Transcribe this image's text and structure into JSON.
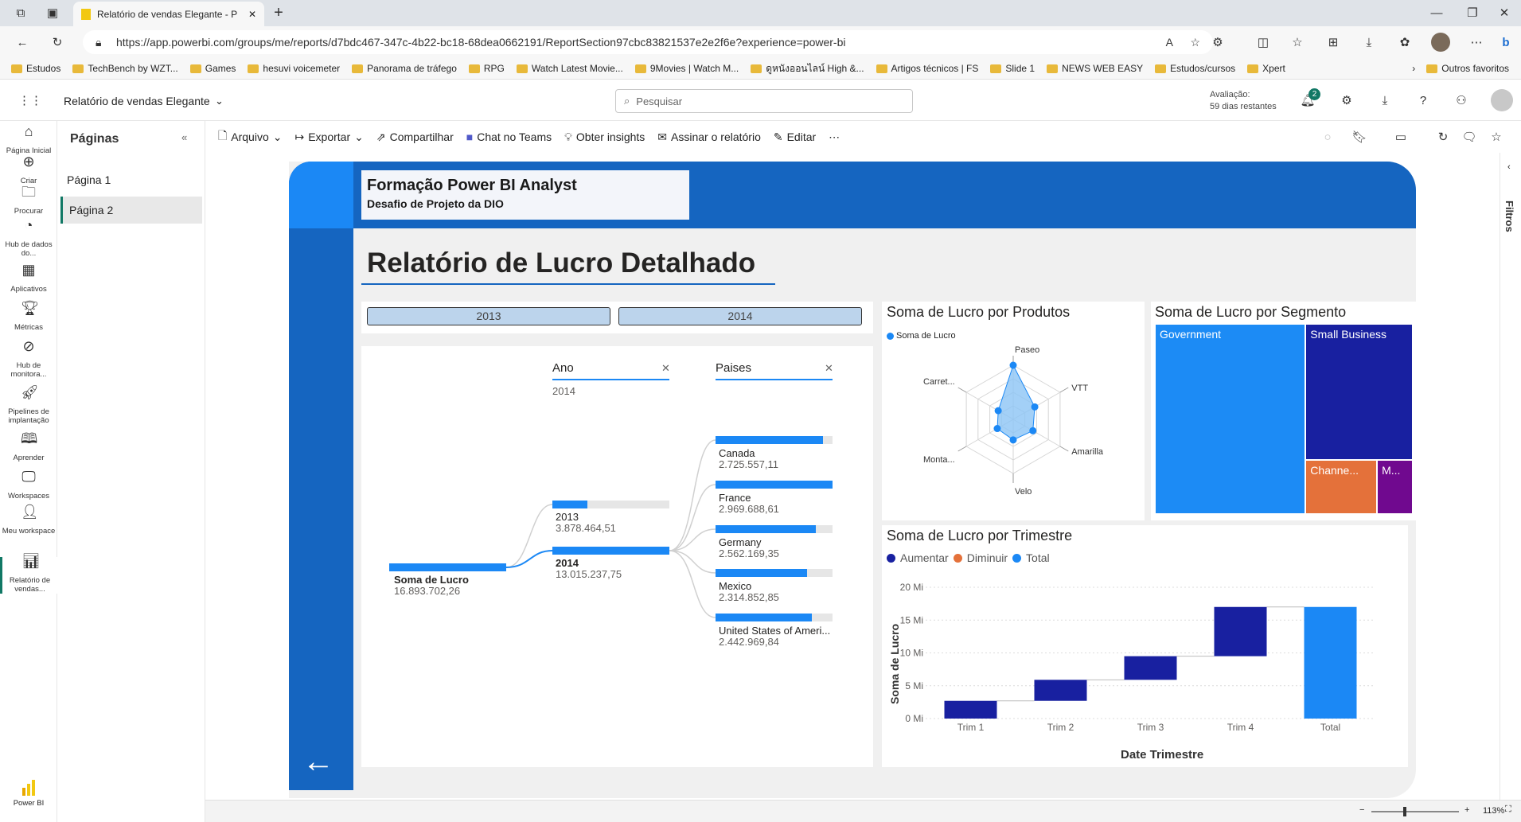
{
  "browser": {
    "tab_title": "Relatório de vendas Elegante - P",
    "url": "https://app.powerbi.com/groups/me/reports/d7bdc467-347c-4b22-bc18-68dea0662191/ReportSection97cbc83821537e2e2f6e?experience=power-bi",
    "bookmarks": [
      "Estudos",
      "TechBench by WZT...",
      "Games",
      "hesuvi voicemeter",
      "Panorama de tráfego",
      "RPG",
      "Watch Latest Movie...",
      "9Movies | Watch M...",
      "ดูหนังออนไลน์ High &...",
      "Artigos técnicos | FS",
      "Slide 1",
      "NEWS WEB EASY",
      "Estudos/cursos",
      "Xpert"
    ],
    "other_favorites": "Outros favoritos"
  },
  "header": {
    "report_name": "Relatório de vendas Elegante",
    "search_placeholder": "Pesquisar",
    "trial_label": "Avaliação:",
    "trial_days": "59 dias restantes",
    "notif_count": "2"
  },
  "nav": [
    {
      "label": "Página Inicial",
      "icon": "home-icon"
    },
    {
      "label": "Criar",
      "icon": "plus-circle-icon"
    },
    {
      "label": "Procurar",
      "icon": "folder-icon"
    },
    {
      "label": "Hub de dados do...",
      "icon": "data-hub-icon"
    },
    {
      "label": "Aplicativos",
      "icon": "apps-icon"
    },
    {
      "label": "Métricas",
      "icon": "trophy-icon"
    },
    {
      "label": "Hub de monitora...",
      "icon": "monitor-icon"
    },
    {
      "label": "Pipelines de implantação",
      "icon": "rocket-icon"
    },
    {
      "label": "Aprender",
      "icon": "book-icon"
    },
    {
      "label": "Workspaces",
      "icon": "workspaces-icon"
    },
    {
      "label": "Meu workspace",
      "icon": "person-icon"
    },
    {
      "label": "Relatório de vendas...",
      "icon": "report-icon"
    }
  ],
  "powerbi_label": "Power BI",
  "pages_panel": {
    "title": "Páginas",
    "pages": [
      "Página 1",
      "Página 2"
    ]
  },
  "toolbar": {
    "arquivo": "Arquivo",
    "exportar": "Exportar",
    "compartilhar": "Compartilhar",
    "teams": "Chat no Teams",
    "insights": "Obter insights",
    "assinar": "Assinar o relatório",
    "editar": "Editar"
  },
  "filters_label": "Filtros",
  "zoom": "113%",
  "report": {
    "banner_title": "Formação Power BI Analyst",
    "banner_subtitle": "Desafio de Projeto da DIO",
    "main_title": "Relatório de Lucro Detalhado",
    "slicer": [
      "2013",
      "2014"
    ],
    "decomp": {
      "col1": "Ano",
      "col1_sel": "2014",
      "col2": "Paises",
      "root_label": "Soma de Lucro",
      "root_value": "16.893.702,26",
      "years": [
        {
          "label": "2013",
          "value": "3.878.464,51",
          "frac": 0.3
        },
        {
          "label": "2014",
          "value": "13.015.237,75",
          "frac": 1.0
        }
      ],
      "countries": [
        {
          "label": "Canada",
          "value": "2.725.557,11",
          "frac": 0.92
        },
        {
          "label": "France",
          "value": "2.969.688,61",
          "frac": 1.0
        },
        {
          "label": "Germany",
          "value": "2.562.169,35",
          "frac": 0.86
        },
        {
          "label": "Mexico",
          "value": "2.314.852,85",
          "frac": 0.78
        },
        {
          "label": "United States of Ameri...",
          "value": "2.442.969,84",
          "frac": 0.82
        }
      ]
    },
    "radar": {
      "title": "Soma de Lucro por Produtos",
      "legend": "Soma de Lucro"
    },
    "treemap": {
      "title": "Soma de Lucro por Segmento",
      "segments": [
        "Government",
        "Small Business",
        "Channe...",
        "M..."
      ]
    },
    "waterfall": {
      "title": "Soma de Lucro por Trimestre",
      "legend": [
        "Aumentar",
        "Diminuir",
        "Total"
      ],
      "ylabel": "Soma de Lucro",
      "xlabel": "Date Trimestre",
      "yticks": [
        "20 Mi",
        "15 Mi",
        "10 Mi",
        "5 Mi",
        "0 Mi"
      ]
    }
  },
  "chart_data": [
    {
      "type": "radar",
      "title": "Soma de Lucro por Produtos",
      "categories": [
        "Paseo",
        "VTT",
        "Amarilla",
        "Velo",
        "Monta...",
        "Carret..."
      ],
      "series": [
        {
          "name": "Soma de Lucro",
          "values": [
            5.0,
            2.3,
            2.1,
            1.9,
            1.7,
            1.6
          ]
        }
      ],
      "unit": "Mi (estimated)"
    },
    {
      "type": "treemap",
      "title": "Soma de Lucro por Segmento",
      "categories": [
        "Government",
        "Small Business",
        "Channel Partners",
        "Midmarket"
      ],
      "values": [
        10.4,
        5.3,
        1.4,
        0.7
      ],
      "colors": [
        "#1c8bf5",
        "#1820a0",
        "#e4713a",
        "#70098f"
      ]
    },
    {
      "type": "waterfall",
      "title": "Soma de Lucro por Trimestre",
      "categories": [
        "Trim 1",
        "Trim 2",
        "Trim 3",
        "Trim 4",
        "Total"
      ],
      "values": [
        2.7,
        3.2,
        3.6,
        7.5,
        17.0
      ],
      "kind": [
        "increase",
        "increase",
        "increase",
        "increase",
        "total"
      ],
      "xlabel": "Date Trimestre",
      "ylabel": "Soma de Lucro",
      "ylim": [
        0,
        20
      ]
    }
  ]
}
